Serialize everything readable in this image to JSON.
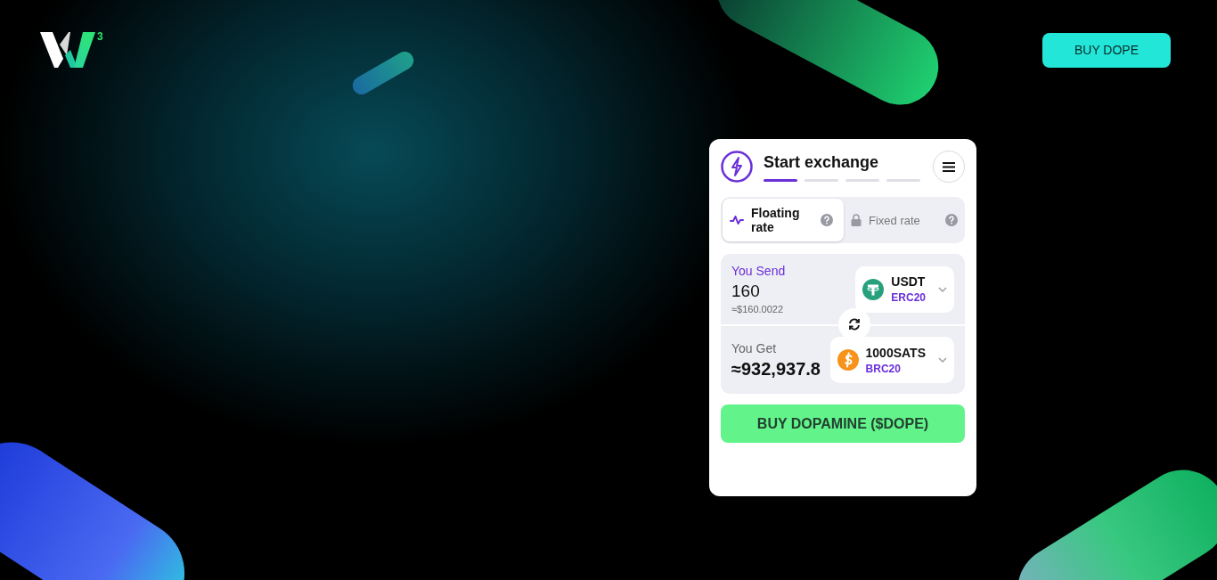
{
  "header": {
    "logo_superscript": "3",
    "button": "BUY DOPE"
  },
  "widget": {
    "title": "Start exchange",
    "steps": [
      {
        "selected": true
      },
      {
        "selected": false
      },
      {
        "selected": false
      },
      {
        "selected": false
      }
    ],
    "rate_tabs": [
      {
        "kind": "floating",
        "label": "Floating rate",
        "selected": true
      },
      {
        "kind": "fixed",
        "label": "Fixed rate",
        "selected": false
      }
    ],
    "send": {
      "label": "You Send",
      "amount": "160",
      "usd": "≈$160.0022",
      "coin": "USDT",
      "network": "ERC20",
      "kind": "tether"
    },
    "get": {
      "label": "You Get",
      "amount": "≈932,937.8",
      "coin": "1000SATS",
      "network": "BRC20",
      "kind": "sats"
    },
    "action": "BUY DOPAMINE ($DOPE)"
  }
}
